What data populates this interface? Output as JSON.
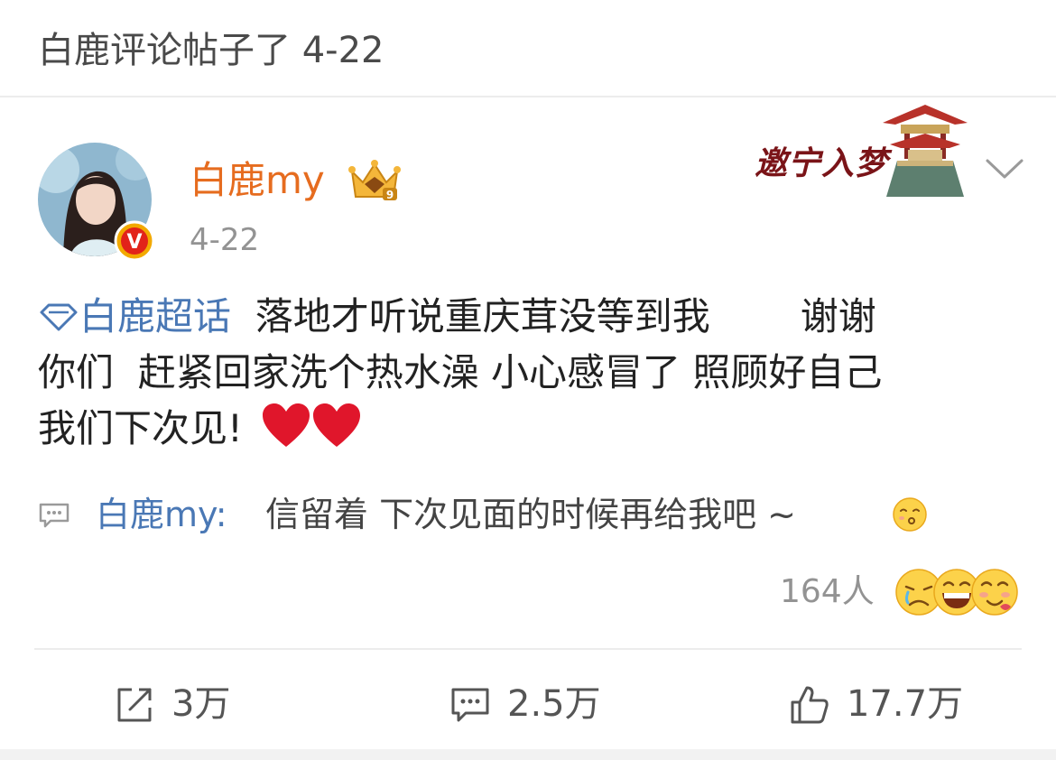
{
  "header": {
    "title": "白鹿评论帖子了 4-22"
  },
  "post": {
    "author": {
      "name": "白鹿my",
      "avatar_icon": "avatar-photo",
      "verified_badge": "V",
      "crown_icon": "crown-icon",
      "crown_level": "9",
      "name_color": "#e66c1f"
    },
    "date": "4-22",
    "banner": {
      "text": "邀宁入梦",
      "icon": "pavilion-icon"
    },
    "more_icon": "chevron-down-icon",
    "content": {
      "topic_label": "白鹿超话",
      "line_1": "落地才听说重庆茸没等到我",
      "line_1_end": "谢谢",
      "line_2": "你们  赶紧回家洗个热水澡 小心感冒了 照顾好自己",
      "line_3": "我们下次见!",
      "hearts": "❤❤"
    },
    "reply": {
      "icon": "comment-icon",
      "author": "白鹿my:",
      "text": "信留着 下次见面的时候再给我吧 ~",
      "emoji": "kiss-emoji"
    },
    "reactions": {
      "count": "164人",
      "emojis": [
        "crying-emoji",
        "laughing-emoji",
        "smitten-emoji"
      ]
    },
    "actions": {
      "repost": {
        "icon": "repost-icon",
        "count": "3万"
      },
      "comment": {
        "icon": "comment-icon",
        "count": "2.5万"
      },
      "like": {
        "icon": "like-icon",
        "count": "17.7万"
      }
    },
    "colors": {
      "link": "#4a78b5",
      "muted": "#939393",
      "heart": "#e0162b"
    }
  }
}
